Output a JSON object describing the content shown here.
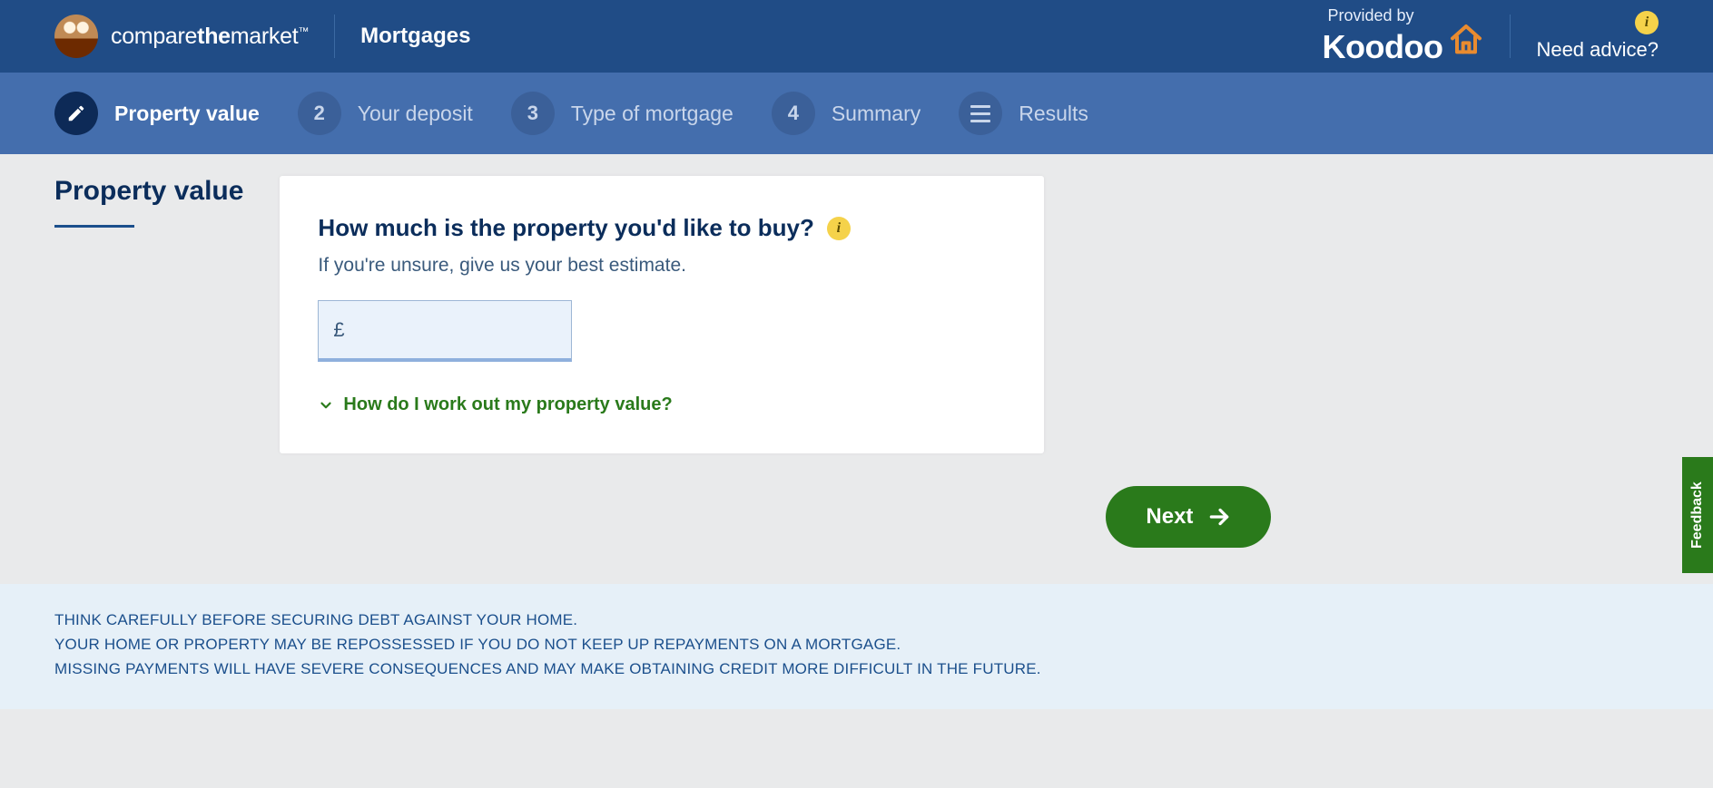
{
  "header": {
    "brand_compare": "compare",
    "brand_the": "the",
    "brand_market": "market",
    "brand_tm": "™",
    "section": "Mortgages",
    "provided_by": "Provided by",
    "koodoo": "Koodoo",
    "need_advice": "Need advice?"
  },
  "stepper": {
    "items": [
      {
        "label": "Property value"
      },
      {
        "num": "2",
        "label": "Your deposit"
      },
      {
        "num": "3",
        "label": "Type of mortgage"
      },
      {
        "num": "4",
        "label": "Summary"
      },
      {
        "label": "Results"
      }
    ]
  },
  "page": {
    "title": "Property value",
    "question": "How much is the property you'd like to buy?",
    "subtext": "If you're unsure, give us your best estimate.",
    "currency": "£",
    "input_value": "",
    "help_link": "How do I work out my property value?",
    "next": "Next"
  },
  "disclaimer": {
    "line1": "THINK CAREFULLY BEFORE SECURING DEBT AGAINST YOUR HOME.",
    "line2": "YOUR HOME OR PROPERTY MAY BE REPOSSESSED IF YOU DO NOT KEEP UP REPAYMENTS ON A MORTGAGE.",
    "line3": "MISSING PAYMENTS WILL HAVE SEVERE CONSEQUENCES AND MAY MAKE OBTAINING CREDIT MORE DIFFICULT IN THE FUTURE."
  },
  "feedback": "Feedback",
  "colors": {
    "header_bg": "#204c86",
    "stepper_bg": "#446ead",
    "accent_green": "#2a7a1b",
    "info_yellow": "#f5d24a",
    "house_orange": "#e98b2f"
  }
}
